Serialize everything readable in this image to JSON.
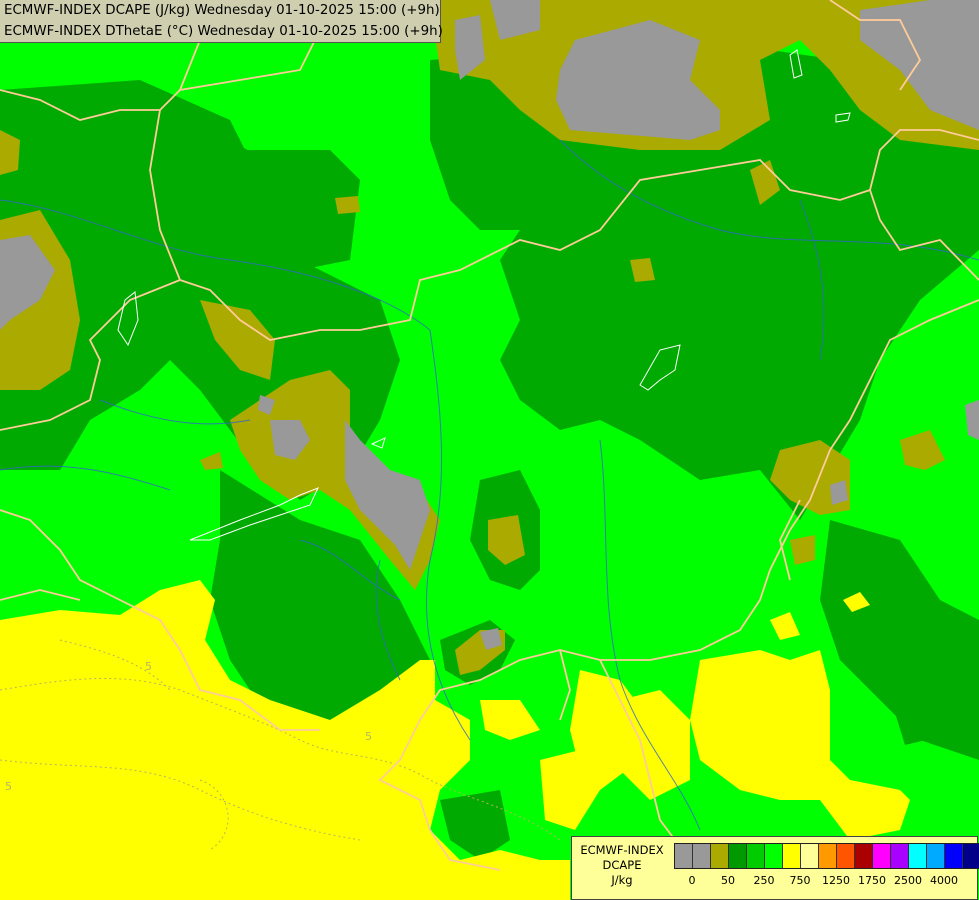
{
  "title": {
    "line1": "ECMWF-INDEX DCAPE (J/kg) Wednesday 01-10-2025 15:00 (+9h)",
    "line2": "ECMWF-INDEX DThetaE (°C) Wednesday 01-10-2025 15:00 (+9h)"
  },
  "legend": {
    "line1": "ECMWF-INDEX",
    "line2": "DCAPE",
    "line3": "J/kg",
    "colors": [
      "#999999",
      "#999999",
      "#aaaa00",
      "#009900",
      "#00cc00",
      "#00ff00",
      "#ffff00",
      "#ffff99",
      "#ff9900",
      "#ff5500",
      "#aa0000",
      "#ff00ff",
      "#aa00ff",
      "#00ffff",
      "#00aaff",
      "#0000ff",
      "#000088"
    ],
    "ticks": [
      "0",
      "50",
      "250",
      "750",
      "1250",
      "1750",
      "2500",
      "4000"
    ]
  },
  "map_colors": {
    "bright_green": "#00ff00",
    "dark_green": "#00aa00",
    "olive": "#aaaa00",
    "gray": "#999999",
    "yellow": "#ffff00",
    "border": "#ffcc99",
    "river": "#3366cc"
  },
  "contour_labels": [
    "5",
    "5",
    "5"
  ]
}
